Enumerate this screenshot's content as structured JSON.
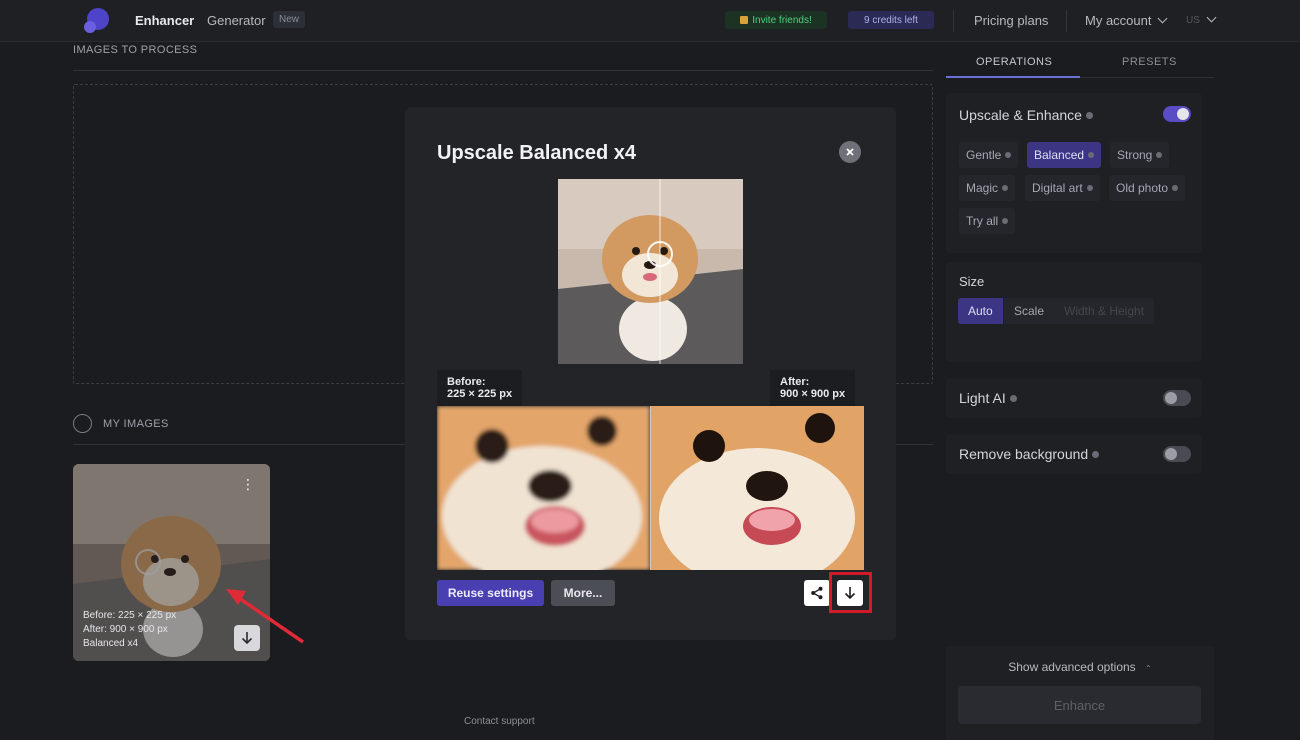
{
  "nav": {
    "enhancer": "Enhancer",
    "generator": "Generator",
    "new_badge": "New",
    "invite": "Invite friends!",
    "credits": "9 credits left",
    "pricing": "Pricing plans",
    "account": "My account",
    "language": "US"
  },
  "main": {
    "images_to_process": "IMAGES TO PROCESS",
    "my_images": "MY IMAGES",
    "thumbnail": {
      "before": "Before:  225 × 225 px",
      "after": "After:    900 × 900 px",
      "mode": "Balanced x4"
    },
    "contact": "Contact support"
  },
  "sidebar": {
    "tabs": [
      "OPERATIONS",
      "PRESETS"
    ],
    "upscale": {
      "title": "Upscale & Enhance",
      "enabled": true,
      "modes": [
        "Gentle",
        "Balanced",
        "Strong",
        "Magic",
        "Digital art",
        "Old photo",
        "Try all"
      ],
      "selected": "Balanced"
    },
    "size": {
      "title": "Size",
      "options": [
        "Auto",
        "Scale",
        "Width & Height"
      ],
      "selected": "Auto"
    },
    "light_ai": {
      "title": "Light AI",
      "enabled": false
    },
    "remove_bg": {
      "title": "Remove background",
      "enabled": false
    },
    "advanced": "Show advanced options",
    "enhance_button": "Enhance"
  },
  "modal": {
    "title": "Upscale Balanced x4",
    "before_label": "Before:",
    "before_size": "225 × 225 px",
    "after_label": "After:",
    "after_size": "900 × 900 px",
    "reuse_button": "Reuse settings",
    "more_button": "More..."
  },
  "colors": {
    "accent": "#4a3fb0",
    "highlight": "#d11b2a",
    "toggle_on": "#5a4cc4"
  }
}
